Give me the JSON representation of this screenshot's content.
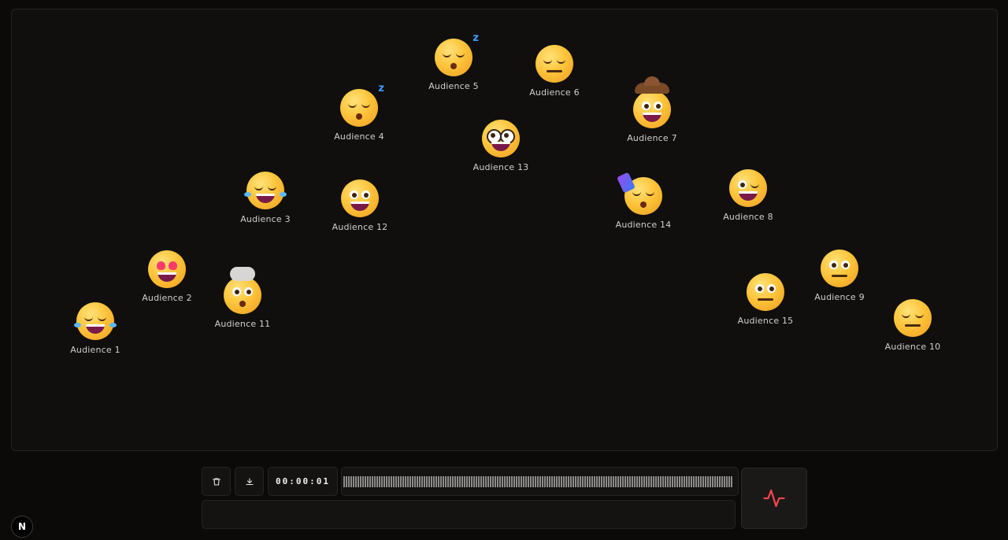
{
  "audience": [
    {
      "name": "Audience 1"
    },
    {
      "name": "Audience 2"
    },
    {
      "name": "Audience 3"
    },
    {
      "name": "Audience 4"
    },
    {
      "name": "Audience 5"
    },
    {
      "name": "Audience 6"
    },
    {
      "name": "Audience 7"
    },
    {
      "name": "Audience 8"
    },
    {
      "name": "Audience 9"
    },
    {
      "name": "Audience 10"
    },
    {
      "name": "Audience 11"
    },
    {
      "name": "Audience 12"
    },
    {
      "name": "Audience 13"
    },
    {
      "name": "Audience 14"
    },
    {
      "name": "Audience 15"
    }
  ],
  "recorder": {
    "delete_icon": "trash-icon",
    "download_icon": "download-icon",
    "timer": "00:00:01"
  },
  "colors": {
    "accent": "#f0454a"
  },
  "logo": {
    "letter": "N"
  }
}
